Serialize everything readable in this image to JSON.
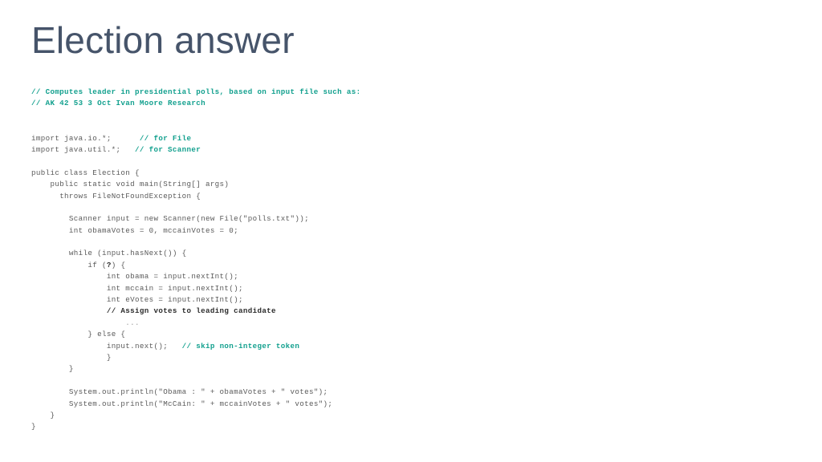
{
  "slide": {
    "title": "Election answer",
    "title_color": "#46546a",
    "background_color": "#ffffff"
  },
  "palette": {
    "code": "#5a5a5a",
    "comment": "#12a08e",
    "emphasis": "#2b2b2b",
    "faint": "#9a9a9a"
  },
  "code": {
    "language": "java",
    "lines": [
      {
        "indent": 0,
        "segments": [
          {
            "text": "// Computes leader in presidential polls, based on input file such as:",
            "style": "comment"
          }
        ]
      },
      {
        "indent": 0,
        "segments": [
          {
            "text": "// AK 42 53 3 Oct Ivan Moore Research",
            "style": "comment"
          }
        ]
      },
      {
        "indent": 0,
        "segments": [
          {
            "text": "",
            "style": "blank"
          }
        ]
      },
      {
        "indent": 0,
        "segments": [
          {
            "text": "",
            "style": "blank"
          }
        ]
      },
      {
        "indent": 0,
        "segments": [
          {
            "text": "import java.io.*;",
            "style": "code"
          },
          {
            "text": "      ",
            "style": "code"
          },
          {
            "text": "// for File",
            "style": "comment"
          }
        ]
      },
      {
        "indent": 0,
        "segments": [
          {
            "text": "import java.util.*;",
            "style": "code"
          },
          {
            "text": "   ",
            "style": "code"
          },
          {
            "text": "// for Scanner",
            "style": "comment"
          }
        ]
      },
      {
        "indent": 0,
        "segments": [
          {
            "text": "",
            "style": "blank"
          }
        ]
      },
      {
        "indent": 0,
        "segments": [
          {
            "text": "public class Election {",
            "style": "code"
          }
        ]
      },
      {
        "indent": 1,
        "segments": [
          {
            "text": "public static void main(String[] args)",
            "style": "code"
          }
        ]
      },
      {
        "indent": 1,
        "segments": [
          {
            "text": "  throws FileNotFoundException {",
            "style": "code"
          }
        ]
      },
      {
        "indent": 0,
        "segments": [
          {
            "text": "",
            "style": "blank"
          }
        ]
      },
      {
        "indent": 2,
        "segments": [
          {
            "text": "Scanner input = new Scanner(new File(\"polls.txt\"));",
            "style": "code"
          }
        ]
      },
      {
        "indent": 2,
        "segments": [
          {
            "text": "int obamaVotes = 0, mccainVotes = 0;",
            "style": "code"
          }
        ]
      },
      {
        "indent": 0,
        "segments": [
          {
            "text": "",
            "style": "blank"
          }
        ]
      },
      {
        "indent": 2,
        "segments": [
          {
            "text": "while (input.hasNext()) {",
            "style": "code"
          }
        ]
      },
      {
        "indent": 3,
        "segments": [
          {
            "text": "if (",
            "style": "code"
          },
          {
            "text": "?",
            "style": "dark"
          },
          {
            "text": ") {",
            "style": "code"
          }
        ]
      },
      {
        "indent": 4,
        "segments": [
          {
            "text": "int obama = input.nextInt();",
            "style": "code"
          }
        ]
      },
      {
        "indent": 4,
        "segments": [
          {
            "text": "int mccain = input.nextInt();",
            "style": "code"
          }
        ]
      },
      {
        "indent": 4,
        "segments": [
          {
            "text": "int eVotes = input.nextInt();",
            "style": "code"
          }
        ]
      },
      {
        "indent": 4,
        "segments": [
          {
            "text": "// Assign votes to leading candidate",
            "style": "dark"
          }
        ]
      },
      {
        "indent": 5,
        "segments": [
          {
            "text": "...",
            "style": "faint"
          }
        ]
      },
      {
        "indent": 3,
        "segments": [
          {
            "text": "} else {",
            "style": "code"
          }
        ]
      },
      {
        "indent": 4,
        "segments": [
          {
            "text": "input.next();",
            "style": "code"
          },
          {
            "text": "   ",
            "style": "code"
          },
          {
            "text": "// skip non-integer token",
            "style": "comment"
          }
        ]
      },
      {
        "indent": 4,
        "segments": [
          {
            "text": "}",
            "style": "code"
          }
        ]
      },
      {
        "indent": 2,
        "segments": [
          {
            "text": "}",
            "style": "code"
          }
        ]
      },
      {
        "indent": 0,
        "segments": [
          {
            "text": "",
            "style": "blank"
          }
        ]
      },
      {
        "indent": 2,
        "segments": [
          {
            "text": "System.out.println(\"Obama : \" + obamaVotes + \" votes\");",
            "style": "code"
          }
        ]
      },
      {
        "indent": 2,
        "segments": [
          {
            "text": "System.out.println(\"McCain: \" + mccainVotes + \" votes\");",
            "style": "code"
          }
        ]
      },
      {
        "indent": 1,
        "segments": [
          {
            "text": "}",
            "style": "code"
          }
        ]
      },
      {
        "indent": 0,
        "segments": [
          {
            "text": "}",
            "style": "code"
          }
        ]
      }
    ]
  }
}
